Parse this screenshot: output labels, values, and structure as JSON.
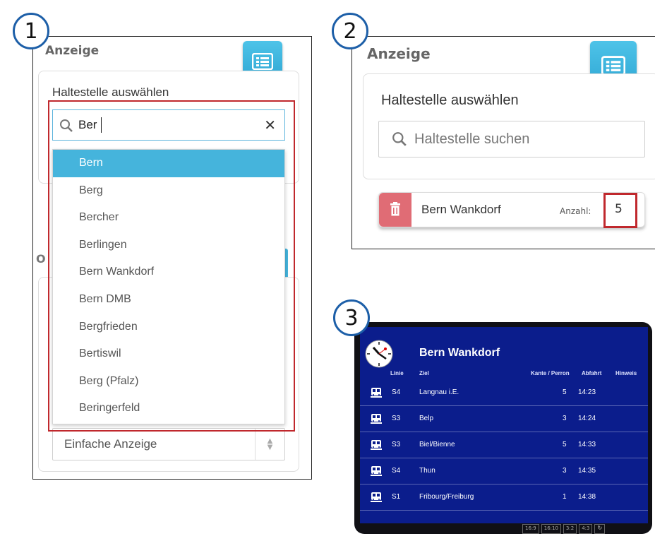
{
  "badges": [
    "1",
    "2",
    "3"
  ],
  "panel1": {
    "heading": "Anzeige",
    "select_label": "Haltestelle auswählen",
    "search_value": "Ber",
    "results": [
      "Bern",
      "Berg",
      "Bercher",
      "Berlingen",
      "Bern Wankdorf",
      "Bern DMB",
      "Bergfrieden",
      "Bertiswil",
      "Berg (Pfalz)",
      "Beringerfeld"
    ],
    "selected_index": 0,
    "display_type": "Einfache Anzeige",
    "partial_letter": "O"
  },
  "panel2": {
    "heading": "Anzeige",
    "select_label": "Haltestelle auswählen",
    "search_placeholder": "Haltestelle suchen",
    "station": "Bern Wankdorf",
    "count_label": "Anzahl:",
    "count_value": "5"
  },
  "board": {
    "title": "Bern Wankdorf",
    "headers": {
      "linie": "Linie",
      "ziel": "Ziel",
      "kante": "Kante / Perron",
      "abfahrt": "Abfahrt",
      "hinweis": "Hinweis"
    },
    "rows": [
      {
        "linie": "S4",
        "ziel": "Langnau i.E.",
        "kante": "5",
        "abfahrt": "14:23"
      },
      {
        "linie": "S3",
        "ziel": "Belp",
        "kante": "3",
        "abfahrt": "14:24"
      },
      {
        "linie": "S3",
        "ziel": "Biel/Bienne",
        "kante": "5",
        "abfahrt": "14:33"
      },
      {
        "linie": "S4",
        "ziel": "Thun",
        "kante": "3",
        "abfahrt": "14:35"
      },
      {
        "linie": "S1",
        "ziel": "Fribourg/Freiburg",
        "kante": "1",
        "abfahrt": "14:38"
      }
    ],
    "aspect_ratios": [
      "16:9",
      "16:10",
      "3:2",
      "4:3"
    ]
  },
  "colors": {
    "accent": "#45b4dc",
    "highlight": "#c0282d",
    "board_bg": "#0b1d8c",
    "delete": "#e06c75"
  }
}
